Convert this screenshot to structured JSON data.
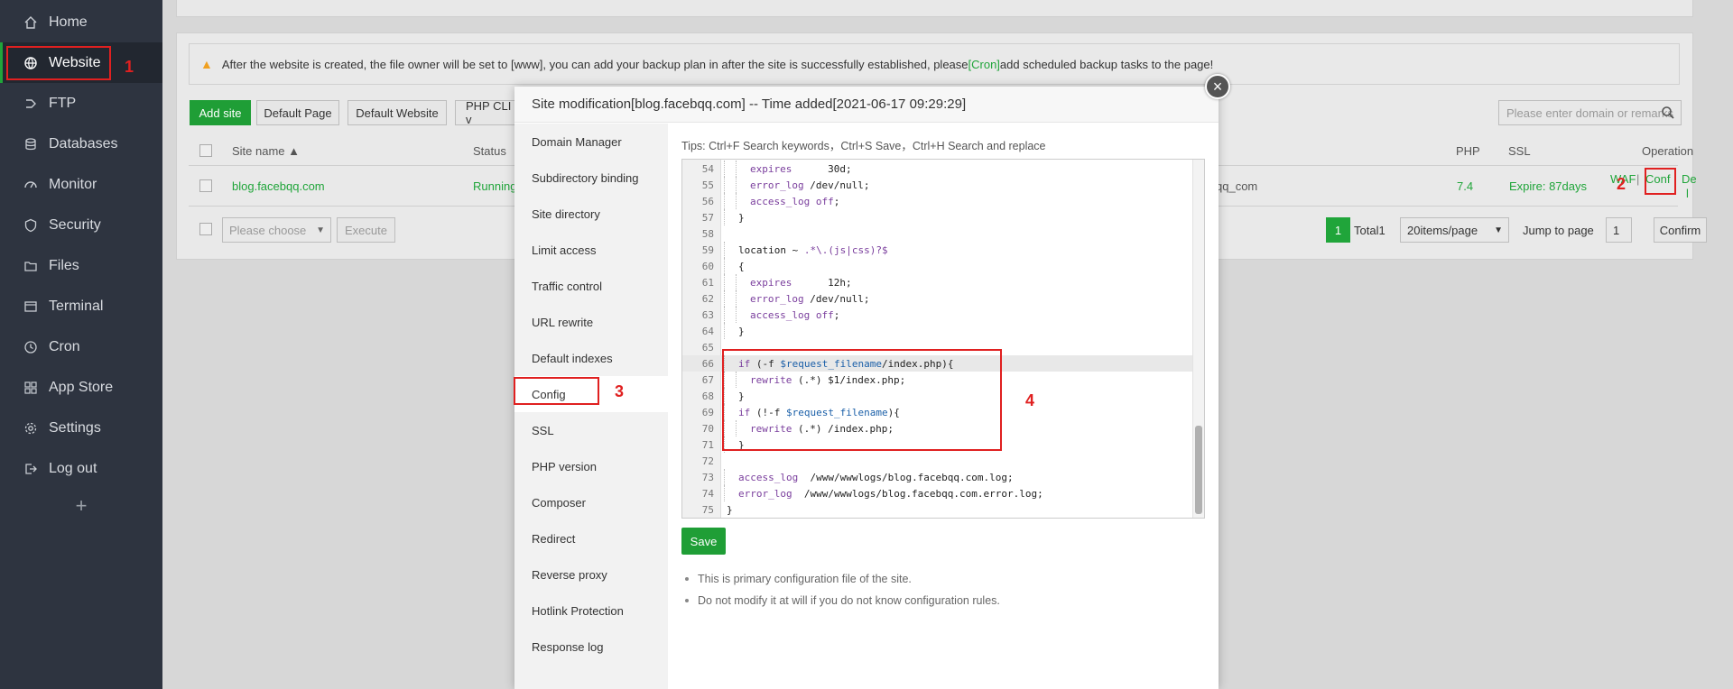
{
  "sidebar": {
    "items": [
      {
        "label": "Home",
        "icon": "home-icon"
      },
      {
        "label": "Website",
        "icon": "globe-icon"
      },
      {
        "label": "FTP",
        "icon": "ftp-icon"
      },
      {
        "label": "Databases",
        "icon": "database-icon"
      },
      {
        "label": "Monitor",
        "icon": "monitor-icon"
      },
      {
        "label": "Security",
        "icon": "shield-icon"
      },
      {
        "label": "Files",
        "icon": "folder-icon"
      },
      {
        "label": "Terminal",
        "icon": "terminal-icon"
      },
      {
        "label": "Cron",
        "icon": "clock-icon"
      },
      {
        "label": "App Store",
        "icon": "grid-icon"
      },
      {
        "label": "Settings",
        "icon": "gear-icon"
      },
      {
        "label": "Log out",
        "icon": "logout-icon"
      }
    ],
    "add_label": "+"
  },
  "annotations": {
    "a1": "1",
    "a2": "2",
    "a3": "3",
    "a4": "4"
  },
  "notice": {
    "text_before": "After the website is created, the file owner will be set to [www], you can add your backup plan in after the site is successfully established, please",
    "link": "[Cron]",
    "text_after": "add scheduled backup tasks to the page!"
  },
  "toolbar": {
    "add_site": "Add site",
    "default_page": "Default Page",
    "default_website": "Default Website",
    "php_cli": "PHP CLI v",
    "search_placeholder": "Please enter domain or remarks"
  },
  "table": {
    "headers": {
      "site_name": "Site name ▲",
      "status": "Status",
      "php": "PHP",
      "ssl": "SSL",
      "operation": "Operation"
    },
    "row": {
      "site": "blog.facebqq.com",
      "status": "Running",
      "backup": "qq_com",
      "php": "7.4",
      "ssl": "Expire: 87days",
      "waf": "WAF",
      "sep": "|",
      "conf": "Conf",
      "del_a": "De",
      "del_b": "l"
    }
  },
  "bottom_bar": {
    "choose_placeholder": "Please choose",
    "execute": "Execute",
    "page": "1",
    "total": "Total1",
    "per_page": "20items/page",
    "jump_label": "Jump to page",
    "jump_value": "1",
    "confirm": "Confirm"
  },
  "modal": {
    "title": "Site modification[blog.facebqq.com] -- Time added[2021-06-17 09:29:29]",
    "close": "×",
    "tabs": [
      "Domain Manager",
      "Subdirectory binding",
      "Site directory",
      "Limit access",
      "Traffic control",
      "URL rewrite",
      "Default indexes",
      "Config",
      "SSL",
      "PHP version",
      "Composer",
      "Redirect",
      "Reverse proxy",
      "Hotlink Protection",
      "Response log"
    ],
    "active_tab": 7,
    "tips": "Tips:  Ctrl+F Search keywords，Ctrl+S Save，Ctrl+H Search and replace",
    "save": "Save",
    "notes": [
      "This is primary configuration file of the site.",
      "Do not modify it at will if you do not know configuration rules."
    ]
  },
  "editor": {
    "lines": [
      {
        "n": "54",
        "indent": 2,
        "parts": [
          [
            "kw",
            "expires"
          ],
          [
            "t",
            "      30d;"
          ]
        ]
      },
      {
        "n": "55",
        "indent": 2,
        "parts": [
          [
            "kw",
            "error_log"
          ],
          [
            "t",
            " /dev/null;"
          ]
        ]
      },
      {
        "n": "56",
        "indent": 2,
        "parts": [
          [
            "kw",
            "access_log"
          ],
          [
            "t",
            " "
          ],
          [
            "kw",
            "off"
          ],
          [
            "t",
            ";"
          ]
        ]
      },
      {
        "n": "57",
        "indent": 1,
        "parts": [
          [
            "t",
            "}"
          ]
        ]
      },
      {
        "n": "58",
        "indent": 0,
        "parts": [
          [
            "t",
            ""
          ]
        ]
      },
      {
        "n": "59",
        "indent": 1,
        "parts": [
          [
            "t",
            "location ~ "
          ],
          [
            "kw",
            ".*\\.(js|css)?$"
          ]
        ]
      },
      {
        "n": "60",
        "indent": 1,
        "parts": [
          [
            "t",
            "{"
          ]
        ]
      },
      {
        "n": "61",
        "indent": 2,
        "parts": [
          [
            "kw",
            "expires"
          ],
          [
            "t",
            "      12h;"
          ]
        ]
      },
      {
        "n": "62",
        "indent": 2,
        "parts": [
          [
            "kw",
            "error_log"
          ],
          [
            "t",
            " /dev/null;"
          ]
        ]
      },
      {
        "n": "63",
        "indent": 2,
        "parts": [
          [
            "kw",
            "access_log"
          ],
          [
            "t",
            " "
          ],
          [
            "kw",
            "off"
          ],
          [
            "t",
            ";"
          ]
        ]
      },
      {
        "n": "64",
        "indent": 1,
        "parts": [
          [
            "t",
            "}"
          ]
        ]
      },
      {
        "n": "65",
        "indent": 0,
        "parts": [
          [
            "t",
            ""
          ]
        ]
      },
      {
        "n": "66",
        "indent": 1,
        "parts": [
          [
            "kw",
            "if"
          ],
          [
            "t",
            " (-f "
          ],
          [
            "var",
            "$request_filename"
          ],
          [
            "t",
            "/index.php){"
          ]
        ]
      },
      {
        "n": "67",
        "indent": 2,
        "parts": [
          [
            "kw",
            "rewrite"
          ],
          [
            "t",
            " (.*) $1/index.php;"
          ]
        ]
      },
      {
        "n": "68",
        "indent": 1,
        "parts": [
          [
            "t",
            "}"
          ]
        ]
      },
      {
        "n": "69",
        "indent": 1,
        "parts": [
          [
            "kw",
            "if"
          ],
          [
            "t",
            " (!-f "
          ],
          [
            "var",
            "$request_filename"
          ],
          [
            "t",
            "){"
          ]
        ]
      },
      {
        "n": "70",
        "indent": 2,
        "parts": [
          [
            "kw",
            "rewrite"
          ],
          [
            "t",
            " (.*) /index.php;"
          ]
        ]
      },
      {
        "n": "71",
        "indent": 1,
        "parts": [
          [
            "t",
            "}"
          ]
        ]
      },
      {
        "n": "72",
        "indent": 0,
        "parts": [
          [
            "t",
            ""
          ]
        ]
      },
      {
        "n": "73",
        "indent": 1,
        "parts": [
          [
            "kw",
            "access_log"
          ],
          [
            "t",
            "  /www/wwwlogs/blog.facebqq.com.log;"
          ]
        ]
      },
      {
        "n": "74",
        "indent": 1,
        "parts": [
          [
            "kw",
            "error_log"
          ],
          [
            "t",
            "  /www/wwwlogs/blog.facebqq.com.error.log;"
          ]
        ]
      },
      {
        "n": "75",
        "indent": 0,
        "parts": [
          [
            "t",
            "}"
          ]
        ]
      }
    ],
    "highlight_line": "66"
  }
}
